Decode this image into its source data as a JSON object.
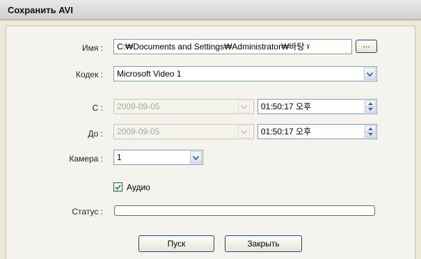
{
  "window": {
    "title": "Сохранить AVI"
  },
  "form": {
    "name_label": "Имя :",
    "name_value": "C:₩Documents and Settings₩Administrator₩바탕 ˠ",
    "browse_label": "...",
    "codec_label": "Кодек :",
    "codec_value": "Microsoft Video 1",
    "from_label": "С :",
    "from_date": "2009-09-05",
    "from_time": "01:50:17 오후",
    "to_label": "До :",
    "to_date": "2009-09-05",
    "to_time": "01:50:17 오후",
    "camera_label": "Камера :",
    "camera_value": "1",
    "audio_label": "Аудио",
    "audio_checked": true,
    "status_label": "Статус :",
    "status_progress": 0
  },
  "buttons": {
    "start": "Пуск",
    "close": "Закрыть"
  },
  "icons": {
    "dropdown": "chevron-down-icon",
    "spin_up": "arrow-up-icon",
    "spin_down": "arrow-down-icon",
    "check": "checkmark-icon"
  }
}
